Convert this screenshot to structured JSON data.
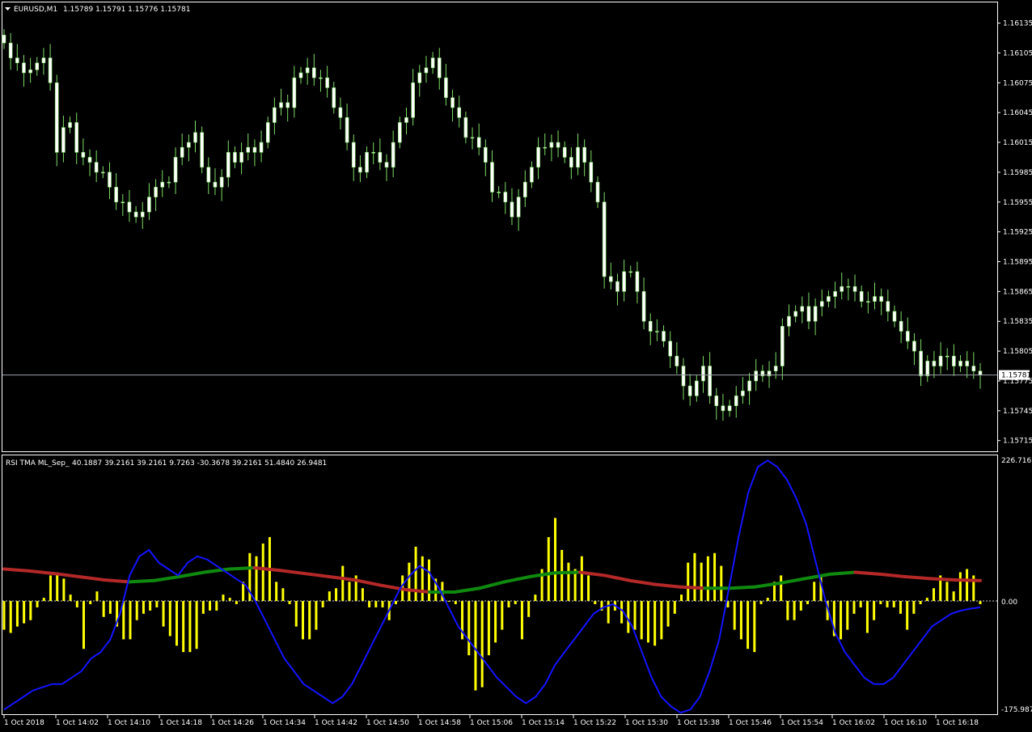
{
  "main_window": {
    "title": "EURUSD,M1",
    "ohlc": "1.15789 1.15791 1.15776 1.15781",
    "current_price_label": "1.15781",
    "price_scale": [
      "1.16135",
      "1.16105",
      "1.16075",
      "1.16045",
      "1.16015",
      "1.15985",
      "1.15955",
      "1.15925",
      "1.15895",
      "1.15865",
      "1.15835",
      "1.15805",
      "1.15775",
      "1.15745",
      "1.15715"
    ]
  },
  "indicator_window": {
    "title": "RSI TMA ML_Sep_",
    "values": "40.1887 39.2161 39.2161 9.7263 -30.3678 39.2161 51.4840 26.9481",
    "scale_top": "226.7162",
    "scale_zero": "0.00",
    "scale_bottom": "-175.9875"
  },
  "time_axis": [
    "1 Oct 2018",
    "1 Oct 14:02",
    "1 Oct 14:10",
    "1 Oct 14:18",
    "1 Oct 14:26",
    "1 Oct 14:34",
    "1 Oct 14:42",
    "1 Oct 14:50",
    "1 Oct 14:58",
    "1 Oct 15:06",
    "1 Oct 15:14",
    "1 Oct 15:22",
    "1 Oct 15:30",
    "1 Oct 15:38",
    "1 Oct 15:46",
    "1 Oct 15:54",
    "1 Oct 16:02",
    "1 Oct 16:10",
    "1 Oct 16:18"
  ],
  "colors": {
    "background": "#000000",
    "grid_border": "#ffffff",
    "candle_body": "#ffffff",
    "candle_wick": "#7fdd66",
    "histogram": "#ffff00",
    "signal_line": "#1414ff",
    "tma_up": "#0f8a0f",
    "tma_down": "#b42828",
    "price_line": "#9aa0a8"
  },
  "chart_data": [
    {
      "type": "candlestick",
      "symbol": "EURUSD",
      "timeframe": "M1",
      "ylim": [
        1.15705,
        1.16155
      ],
      "current_price": 1.15781,
      "closes": [
        1.16115,
        1.161,
        1.16095,
        1.16085,
        1.16088,
        1.16095,
        1.161,
        1.16075,
        1.16005,
        1.1603,
        1.16035,
        1.16005,
        1.16,
        1.15995,
        1.15985,
        1.15985,
        1.1597,
        1.15955,
        1.15955,
        1.15945,
        1.1594,
        1.15945,
        1.1596,
        1.1597,
        1.15975,
        1.15975,
        1.16,
        1.1601,
        1.16015,
        1.16025,
        1.1599,
        1.15975,
        1.1597,
        1.1598,
        1.16005,
        1.15995,
        1.16005,
        1.1601,
        1.16005,
        1.16015,
        1.16035,
        1.1605,
        1.16055,
        1.1605,
        1.1608,
        1.16085,
        1.1609,
        1.1608,
        1.1608,
        1.1607,
        1.1605,
        1.1604,
        1.16015,
        1.1599,
        1.15985,
        1.16005,
        1.16005,
        1.15995,
        1.1599,
        1.16015,
        1.16035,
        1.1604,
        1.16075,
        1.16085,
        1.1609,
        1.161,
        1.1608,
        1.1606,
        1.1605,
        1.1604,
        1.1602,
        1.1602,
        1.1601,
        1.15995,
        1.15965,
        1.15965,
        1.15955,
        1.1594,
        1.1596,
        1.15975,
        1.1599,
        1.1601,
        1.1601,
        1.16015,
        1.1601,
        1.16,
        1.1599,
        1.1601,
        1.15995,
        1.15975,
        1.15955,
        1.1588,
        1.15875,
        1.15865,
        1.15885,
        1.15885,
        1.15865,
        1.15835,
        1.15825,
        1.15825,
        1.15815,
        1.158,
        1.1579,
        1.1577,
        1.1576,
        1.15775,
        1.1579,
        1.1576,
        1.1575,
        1.15745,
        1.1575,
        1.1576,
        1.15765,
        1.15775,
        1.15785,
        1.1578,
        1.15785,
        1.1579,
        1.1583,
        1.1584,
        1.15845,
        1.1585,
        1.15835,
        1.1585,
        1.15855,
        1.1586,
        1.15865,
        1.1587,
        1.1587,
        1.15865,
        1.15855,
        1.15855,
        1.1586,
        1.15855,
        1.15845,
        1.15835,
        1.15825,
        1.15815,
        1.15805,
        1.1578,
        1.15795,
        1.1579,
        1.158,
        1.158,
        1.1579,
        1.15795,
        1.1579,
        1.15785,
        1.15781
      ]
    },
    {
      "type": "bar",
      "name": "RSI TMA ML_Sep_",
      "ylim": [
        -175.9875,
        226.7162
      ],
      "histogram_values": [
        -45,
        -50,
        -40,
        -35,
        -30,
        -10,
        5,
        40,
        45,
        35,
        10,
        -10,
        -75,
        -5,
        15,
        -25,
        -20,
        -40,
        -60,
        -60,
        -30,
        -20,
        -15,
        -10,
        -40,
        -55,
        -70,
        -80,
        -80,
        -75,
        -20,
        -15,
        -15,
        10,
        5,
        -5,
        30,
        75,
        70,
        90,
        100,
        30,
        20,
        -5,
        -40,
        -60,
        -60,
        -45,
        -10,
        15,
        20,
        55,
        30,
        40,
        20,
        -10,
        -10,
        -10,
        -30,
        -5,
        40,
        60,
        85,
        70,
        65,
        35,
        30,
        0,
        -5,
        -60,
        -85,
        -140,
        -135,
        -85,
        -65,
        -45,
        -10,
        -5,
        -60,
        -25,
        10,
        50,
        100,
        130,
        80,
        60,
        50,
        70,
        40,
        -5,
        -15,
        -35,
        -15,
        -35,
        -50,
        -45,
        -60,
        -65,
        -70,
        -60,
        -40,
        -20,
        10,
        60,
        75,
        60,
        70,
        75,
        55,
        -10,
        -45,
        -60,
        -75,
        -80,
        -5,
        5,
        30,
        40,
        -30,
        -30,
        -15,
        -5,
        30,
        40,
        -30,
        -55,
        -60,
        -45,
        -20,
        -10,
        -50,
        -30,
        -5,
        -10,
        -10,
        -20,
        -45,
        -20,
        -5,
        5,
        20,
        40,
        30,
        15,
        45,
        50,
        40,
        -5
      ]
    },
    {
      "type": "line",
      "name": "signal",
      "ylim": [
        -175.9875,
        226.7162
      ],
      "values": [
        -170,
        -160,
        -150,
        -140,
        -135,
        -130,
        -130,
        -120,
        -110,
        -90,
        -80,
        -60,
        -20,
        40,
        70,
        80,
        60,
        50,
        40,
        60,
        70,
        65,
        55,
        45,
        35,
        25,
        0,
        -30,
        -60,
        -90,
        -110,
        -130,
        -140,
        -150,
        -160,
        -150,
        -130,
        -100,
        -70,
        -40,
        -10,
        20,
        40,
        55,
        45,
        20,
        -10,
        -40,
        -60,
        -80,
        -100,
        -120,
        -135,
        -150,
        -160,
        -150,
        -130,
        -100,
        -80,
        -60,
        -40,
        -20,
        -10,
        -5,
        -15,
        -40,
        -80,
        -120,
        -150,
        -165,
        -175,
        -170,
        -150,
        -110,
        -60,
        20,
        100,
        170,
        210,
        220,
        210,
        190,
        160,
        120,
        60,
        0,
        -50,
        -80,
        -100,
        -120,
        -130,
        -130,
        -120,
        -100,
        -80,
        -60,
        -40,
        -30,
        -20,
        -15,
        -12,
        -10
      ]
    },
    {
      "type": "line",
      "name": "TMA",
      "ylim": [
        -175.9875,
        226.7162
      ],
      "values": [
        50,
        47,
        43,
        38,
        33,
        30,
        32,
        38,
        45,
        50,
        52,
        48,
        43,
        38,
        33,
        25,
        18,
        14,
        14,
        20,
        30,
        38,
        44,
        45,
        40,
        32,
        26,
        22,
        20,
        20,
        22,
        28,
        35,
        42,
        45,
        42,
        38,
        35,
        33,
        32
      ]
    }
  ]
}
